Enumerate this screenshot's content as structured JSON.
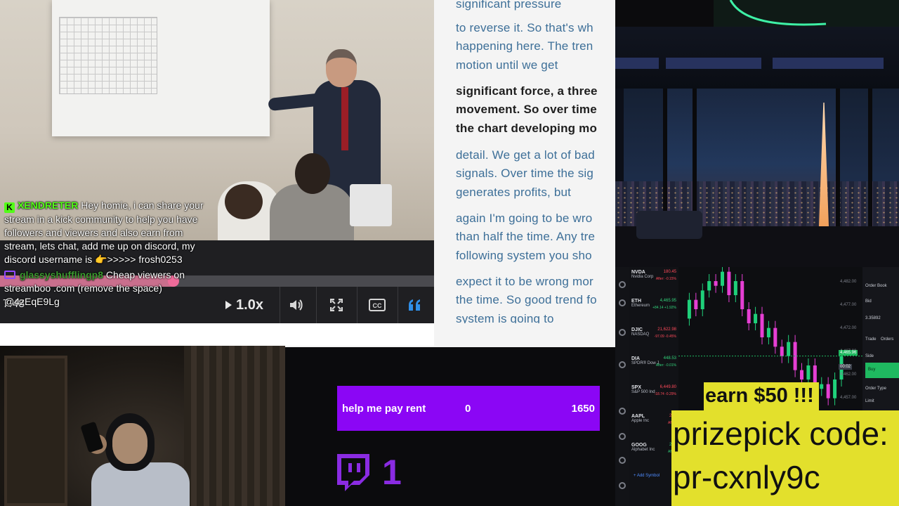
{
  "chat": {
    "msg1": {
      "badge": "K",
      "username": "XENDRETER",
      "text": "Hey homie, i can share your stream in a kick community to help you have followers and viewers and also earn from stream, lets chat, add me up on discord, my discord username is 👉>>>>> frosh0253"
    },
    "msg2": {
      "username": "glassyshufflingp8",
      "text": "Cheap viewers on streamboo .com (remove the space) @4zEqE9Lg"
    }
  },
  "player": {
    "time": "7:48",
    "speed": "1.0x",
    "progress_fraction": 0.4,
    "icons": [
      "play-icon",
      "volume-icon",
      "fullscreen-icon",
      "closed-captions-icon",
      "quote-icon"
    ]
  },
  "transcript": {
    "lines": [
      {
        "text": "significant pressure",
        "bold": false
      },
      {
        "text": "to reverse it. So that's wh",
        "bold": false
      },
      {
        "text": "happening here. The tren",
        "bold": false
      },
      {
        "text": "motion until we get",
        "bold": false
      },
      {
        "text": "significant force, a three",
        "bold": true
      },
      {
        "text": "movement. So over time",
        "bold": true
      },
      {
        "text": "the chart developing mo",
        "bold": true
      },
      {
        "text": "detail. We get a lot of bad",
        "bold": false
      },
      {
        "text": "signals. Over time the sig",
        "bold": false
      },
      {
        "text": "generates profits, but",
        "bold": false
      },
      {
        "text": "again I'm going to be wro",
        "bold": false
      },
      {
        "text": "than half the time. Any tre",
        "bold": false
      },
      {
        "text": "following system you sho",
        "bold": false
      },
      {
        "text": "expect it to be wrong mor",
        "bold": false
      },
      {
        "text": "the time. So good trend fo",
        "bold": false
      },
      {
        "text": "system is going to",
        "bold": false
      }
    ]
  },
  "trading": {
    "watchlist": [
      {
        "sym": "NVDA",
        "name": "Nvidia Corp",
        "price": "180.45",
        "change": "After: -0.15%",
        "dir": "dn"
      },
      {
        "sym": "ETH",
        "name": "Ethereum",
        "price": "4,465.95",
        "change": "+84.14 +1.92%",
        "dir": "up"
      },
      {
        "sym": "DJIC",
        "name": "NASDAQ",
        "price": "21,622.98",
        "change": "-97.09 -0.45%",
        "dir": "dn"
      },
      {
        "sym": "DIA",
        "name": "SPDR® Dow J",
        "price": "448.53",
        "change": "After: -0.01%",
        "dir": "up"
      },
      {
        "sym": "SPX",
        "name": "S&P 500 Ind",
        "price": "6,449.80",
        "change": "-18.74 -0.29%",
        "dir": "dn"
      },
      {
        "sym": "AAPL",
        "name": "Apple Inc",
        "price": "231",
        "change": "After: ",
        "dir": "dn"
      },
      {
        "sym": "GOOG",
        "name": "Alphabet Inc",
        "price": "204",
        "change": "After: ",
        "dir": "up"
      }
    ],
    "add_symbol": "Add Symbol",
    "y_ticks": [
      "4,482.00",
      "4,477.00",
      "4,472.00",
      "4,467.00",
      "4,462.00",
      "4,457.00"
    ],
    "price_tag": "4,465.96",
    "time_tag": "00:02",
    "side": {
      "order_book": "Order Book",
      "bid_label": "Bid",
      "bid_value": "3.35892",
      "tab_trade": "Trade",
      "tab_orders": "Orders",
      "side_label": "Side",
      "buy_label": "Buy",
      "order_type_label": "Order Type",
      "order_type_value": "Limit"
    },
    "price_series": [
      4474,
      4478,
      4476,
      4480,
      4482,
      4481,
      4484,
      4479,
      4482,
      4476,
      4473,
      4475,
      4470,
      4472,
      4468,
      4466,
      4469,
      4463,
      4461,
      4464,
      4459,
      4460,
      4457,
      4461,
      4466
    ]
  },
  "goal": {
    "label": "help me pay rent",
    "current": "0",
    "target": "1650",
    "color": "#8b06f5"
  },
  "twitch": {
    "icon": "twitch-logo-icon",
    "count": "1",
    "color": "#8a2be2"
  },
  "promo": {
    "earn": "earn $50 !!!",
    "code_line1": "prizepick code:",
    "code_line2": "pr-cxnly9c",
    "bg_color": "#e3e02c"
  }
}
